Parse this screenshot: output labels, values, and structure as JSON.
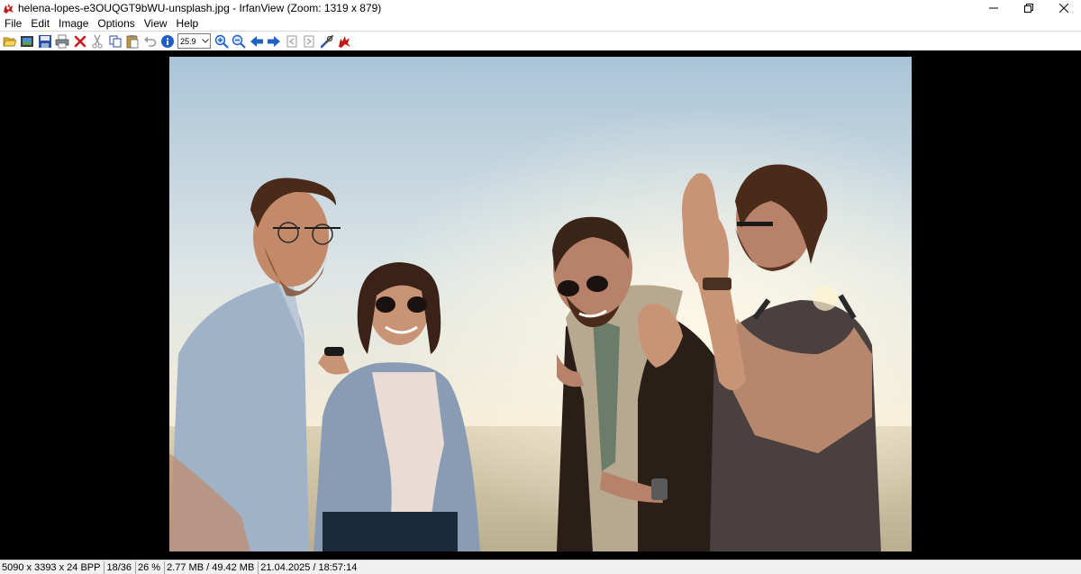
{
  "window": {
    "title": "helena-lopes-e3OUQGT9bWU-unsplash.jpg - IrfanView (Zoom: 1319 x 879)",
    "app_icon": "irfanview-cat-icon",
    "controls": [
      "minimize-icon",
      "restore-icon",
      "close-icon"
    ]
  },
  "menu": {
    "items": [
      "File",
      "Edit",
      "Image",
      "Options",
      "View",
      "Help"
    ]
  },
  "toolbar": {
    "zoom_value": "25.9",
    "icons": [
      "open-folder-icon",
      "slideshow-icon",
      "save-icon",
      "print-icon",
      "delete-icon",
      "cut-icon",
      "copy-icon",
      "paste-icon",
      "undo-icon",
      "info-icon",
      "zoom-in-icon",
      "zoom-out-icon",
      "previous-icon",
      "next-icon",
      "first-page-icon",
      "last-page-icon",
      "properties-icon",
      "about-icon"
    ]
  },
  "image": {
    "description_icon": "photo-icon"
  },
  "status": {
    "dimensions": "5090 x 3393 x 24 BPP",
    "index": "18/36",
    "zoom": "26 %",
    "size": "2.77 MB / 49.42 MB",
    "datetime": "21.04.2025 / 18:57:14"
  },
  "colors": {
    "viewer_bg": "#000000",
    "status_bg": "#f0f0f0",
    "accent_blue": "#1f5fc8"
  }
}
